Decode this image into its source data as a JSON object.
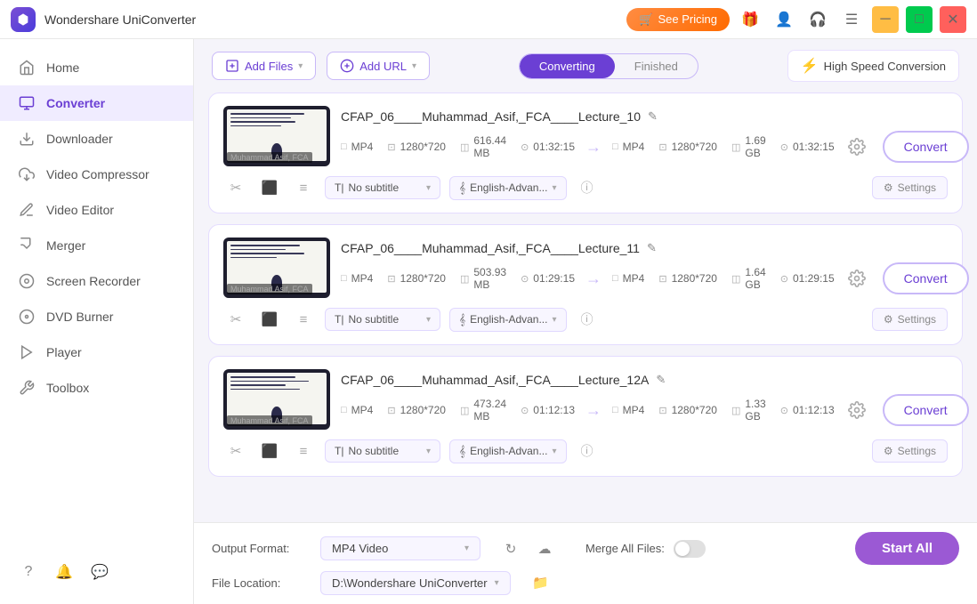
{
  "app": {
    "title": "Wondershare UniConverter",
    "icon": "uni-icon"
  },
  "titlebar": {
    "see_pricing": "See Pricing",
    "gift_icon": "🎁",
    "window_controls": [
      "minimize",
      "maximize",
      "close"
    ]
  },
  "sidebar": {
    "items": [
      {
        "id": "home",
        "label": "Home",
        "icon": "home-icon",
        "active": false
      },
      {
        "id": "converter",
        "label": "Converter",
        "icon": "converter-icon",
        "active": true
      },
      {
        "id": "downloader",
        "label": "Downloader",
        "icon": "downloader-icon",
        "active": false
      },
      {
        "id": "video-compressor",
        "label": "Video Compressor",
        "icon": "compressor-icon",
        "active": false
      },
      {
        "id": "video-editor",
        "label": "Video Editor",
        "icon": "editor-icon",
        "active": false
      },
      {
        "id": "merger",
        "label": "Merger",
        "icon": "merger-icon",
        "active": false
      },
      {
        "id": "screen-recorder",
        "label": "Screen Recorder",
        "icon": "recorder-icon",
        "active": false
      },
      {
        "id": "dvd-burner",
        "label": "DVD Burner",
        "icon": "dvd-icon",
        "active": false
      },
      {
        "id": "player",
        "label": "Player",
        "icon": "player-icon",
        "active": false
      },
      {
        "id": "toolbox",
        "label": "Toolbox",
        "icon": "toolbox-icon",
        "active": false
      }
    ],
    "bottom_icons": [
      "help-icon",
      "notification-icon",
      "chat-icon"
    ]
  },
  "toolbar": {
    "add_files_label": "Add Files",
    "add_url_label": "Add URL",
    "tab_converting": "Converting",
    "tab_finished": "Finished",
    "high_speed_label": "High Speed Conversion",
    "active_tab": "converting"
  },
  "files": [
    {
      "id": "file1",
      "name": "CFAP_06____Muhammad_Asif,_FCA____Lecture_10",
      "thumbnail_label": "Muhammad Asif, FCA",
      "src": {
        "format": "MP4",
        "resolution": "1280*720",
        "size": "616.44 MB",
        "duration": "01:32:15"
      },
      "dest": {
        "format": "MP4",
        "resolution": "1280*720",
        "size": "1.69 GB",
        "duration": "01:32:15"
      },
      "subtitle": "No subtitle",
      "audio": "English-Advan...",
      "convert_label": "Convert",
      "settings_label": "Settings"
    },
    {
      "id": "file2",
      "name": "CFAP_06____Muhammad_Asif,_FCA____Lecture_11",
      "thumbnail_label": "Muhammad Asif, FCA",
      "src": {
        "format": "MP4",
        "resolution": "1280*720",
        "size": "503.93 MB",
        "duration": "01:29:15"
      },
      "dest": {
        "format": "MP4",
        "resolution": "1280*720",
        "size": "1.64 GB",
        "duration": "01:29:15"
      },
      "subtitle": "No subtitle",
      "audio": "English-Advan...",
      "convert_label": "Convert",
      "settings_label": "Settings"
    },
    {
      "id": "file3",
      "name": "CFAP_06____Muhammad_Asif,_FCA____Lecture_12A",
      "thumbnail_label": "Muhammad Asif, FCA",
      "src": {
        "format": "MP4",
        "resolution": "1280*720",
        "size": "473.24 MB",
        "duration": "01:12:13"
      },
      "dest": {
        "format": "MP4",
        "resolution": "1280*720",
        "size": "1.33 GB",
        "duration": "01:12:13"
      },
      "subtitle": "No subtitle",
      "audio": "English-Advan...",
      "convert_label": "Convert",
      "settings_label": "Settings"
    }
  ],
  "bottom": {
    "output_format_label": "Output Format:",
    "output_format_value": "MP4 Video",
    "file_location_label": "File Location:",
    "file_location_value": "D:\\Wondershare UniConverter",
    "merge_all_label": "Merge All Files:",
    "start_all_label": "Start All"
  }
}
